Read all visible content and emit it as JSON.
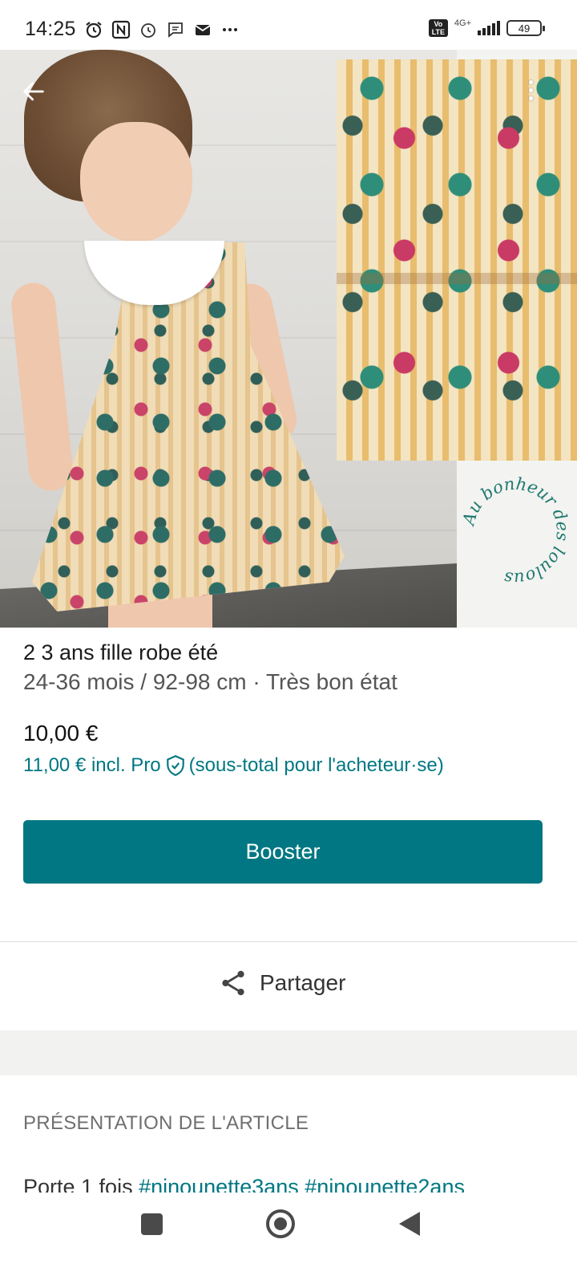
{
  "status_bar": {
    "time": "14:25",
    "volte": "Vo LTE",
    "network": "4G+",
    "battery": "49"
  },
  "photo": {
    "logo_text": "Au bonheur des loulous"
  },
  "item": {
    "title": "2 3 ans fille robe été",
    "subtitle": "24-36 mois / 92-98 cm · Très bon état",
    "price": "10,00 €",
    "pro_price": "11,00 € incl. Pro",
    "pro_note": "(sous-total pour l'acheteur·se)"
  },
  "actions": {
    "booster_label": "Booster",
    "share_label": "Partager"
  },
  "section": {
    "title": "PRÉSENTATION DE L'ARTICLE",
    "description_text": "Porte 1 fois ",
    "hashtag_1": "#ninounette3ans",
    "hashtag_2": "#ninounette2ans"
  },
  "colors": {
    "accent": "#007782",
    "text_secondary": "#555555"
  }
}
